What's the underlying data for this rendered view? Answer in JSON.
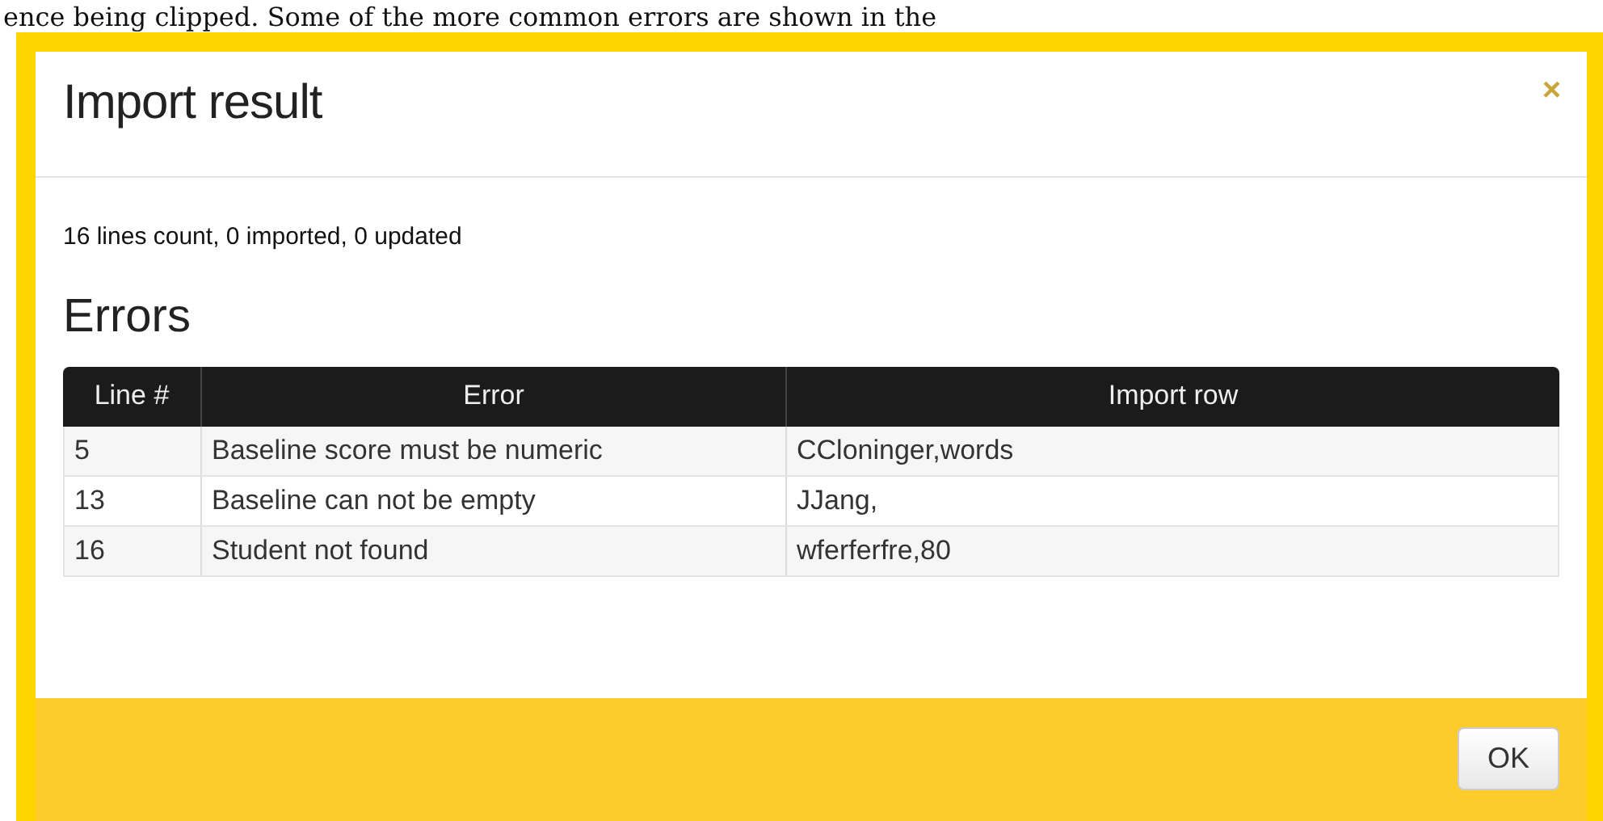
{
  "background_text": "ence being clipped. Some of the more common errors are shown in the",
  "dialog": {
    "title": "Import result",
    "close": "×",
    "summary": "16 lines count, 0 imported, 0 updated",
    "errors_heading": "Errors",
    "table": {
      "columns": [
        "Line #",
        "Error",
        "Import row"
      ],
      "rows": [
        [
          "5",
          "Baseline score must be numeric",
          "CCloninger,words"
        ],
        [
          "13",
          "Baseline can not be empty",
          "JJang,"
        ],
        [
          "16",
          "Student not found",
          "wferferfre,80"
        ]
      ]
    },
    "buttons": [
      "OK"
    ]
  }
}
